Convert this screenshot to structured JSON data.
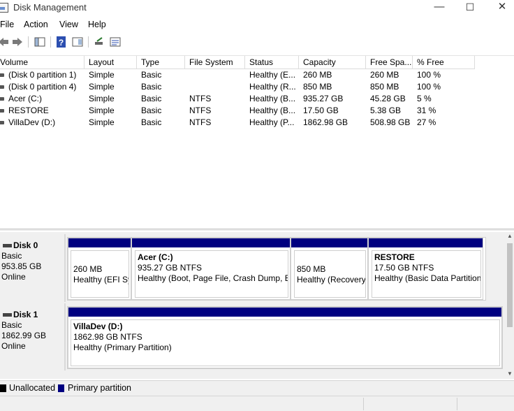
{
  "window": {
    "title": "Disk Management",
    "minimize": "—",
    "maximize": "☐",
    "close": "✕"
  },
  "menu": [
    "File",
    "Action",
    "View",
    "Help"
  ],
  "columns": [
    "Volume",
    "Layout",
    "Type",
    "File System",
    "Status",
    "Capacity",
    "Free Spa...",
    "% Free"
  ],
  "volumes": [
    {
      "volume": "(Disk 0 partition 1)",
      "layout": "Simple",
      "type": "Basic",
      "fs": "",
      "status": "Healthy (E...",
      "capacity": "260 MB",
      "free": "260 MB",
      "pct": "100 %"
    },
    {
      "volume": "(Disk 0 partition 4)",
      "layout": "Simple",
      "type": "Basic",
      "fs": "",
      "status": "Healthy (R...",
      "capacity": "850 MB",
      "free": "850 MB",
      "pct": "100 %"
    },
    {
      "volume": "Acer (C:)",
      "layout": "Simple",
      "type": "Basic",
      "fs": "NTFS",
      "status": "Healthy (B...",
      "capacity": "935.27 GB",
      "free": "45.28 GB",
      "pct": "5 %"
    },
    {
      "volume": "RESTORE",
      "layout": "Simple",
      "type": "Basic",
      "fs": "NTFS",
      "status": "Healthy (B...",
      "capacity": "17.50 GB",
      "free": "5.38 GB",
      "pct": "31 %"
    },
    {
      "volume": "VillaDev (D:)",
      "layout": "Simple",
      "type": "Basic",
      "fs": "NTFS",
      "status": "Healthy (P...",
      "capacity": "1862.98 GB",
      "free": "508.98 GB",
      "pct": "27 %"
    }
  ],
  "disks": [
    {
      "name": "Disk 0",
      "type": "Basic",
      "size": "953.85 GB",
      "state": "Online",
      "partitions": [
        {
          "name": "",
          "size": "260 MB",
          "status": "Healthy (EFI System Partition)"
        },
        {
          "name": "Acer  (C:)",
          "size": "935.27 GB NTFS",
          "status": "Healthy (Boot, Page File, Crash Dump, Basic Data Partition)"
        },
        {
          "name": "",
          "size": "850 MB",
          "status": "Healthy (Recovery Partition)"
        },
        {
          "name": "RESTORE",
          "size": "17.50 GB NTFS",
          "status": "Healthy (Basic Data Partition)"
        }
      ]
    },
    {
      "name": "Disk 1",
      "type": "Basic",
      "size": "1862.99 GB",
      "state": "Online",
      "partitions": [
        {
          "name": "VillaDev  (D:)",
          "size": "1862.98 GB NTFS",
          "status": "Healthy (Primary Partition)"
        }
      ]
    }
  ],
  "legend": {
    "unallocated": "Unallocated",
    "primary": "Primary partition"
  },
  "colors": {
    "primary": "#000080",
    "unallocated": "#000000"
  }
}
